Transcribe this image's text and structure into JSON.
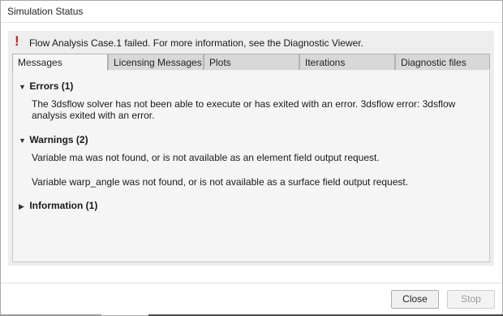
{
  "window": {
    "title": "Simulation Status"
  },
  "status": {
    "icon": "exclamation-icon",
    "message": "Flow Analysis Case.1 failed. For more information, see the Diagnostic Viewer."
  },
  "tabs": [
    {
      "label": "Messages",
      "active": true
    },
    {
      "label": "Licensing Messages"
    },
    {
      "label": "Plots"
    },
    {
      "label": "Iterations"
    },
    {
      "label": "Diagnostic files"
    }
  ],
  "sections": {
    "errors": {
      "title": "Errors (1)",
      "expanded": true,
      "items": [
        "The 3dsflow solver has not been able to execute or has exited with an error. 3dsflow error:  3dsflow analysis exited with an error."
      ]
    },
    "warnings": {
      "title": "Warnings (2)",
      "expanded": true,
      "items": [
        "Variable ma was not found, or is not available as an element field output request.",
        "Variable warp_angle was not found, or is not available as a surface field output request."
      ]
    },
    "information": {
      "title": "Information (1)",
      "expanded": false
    }
  },
  "buttons": {
    "close": "Close",
    "stop": "Stop"
  },
  "colors": {
    "error": "#c41f1f",
    "panel": "#eeeeee",
    "tab_inactive": "#d8d8d8"
  }
}
